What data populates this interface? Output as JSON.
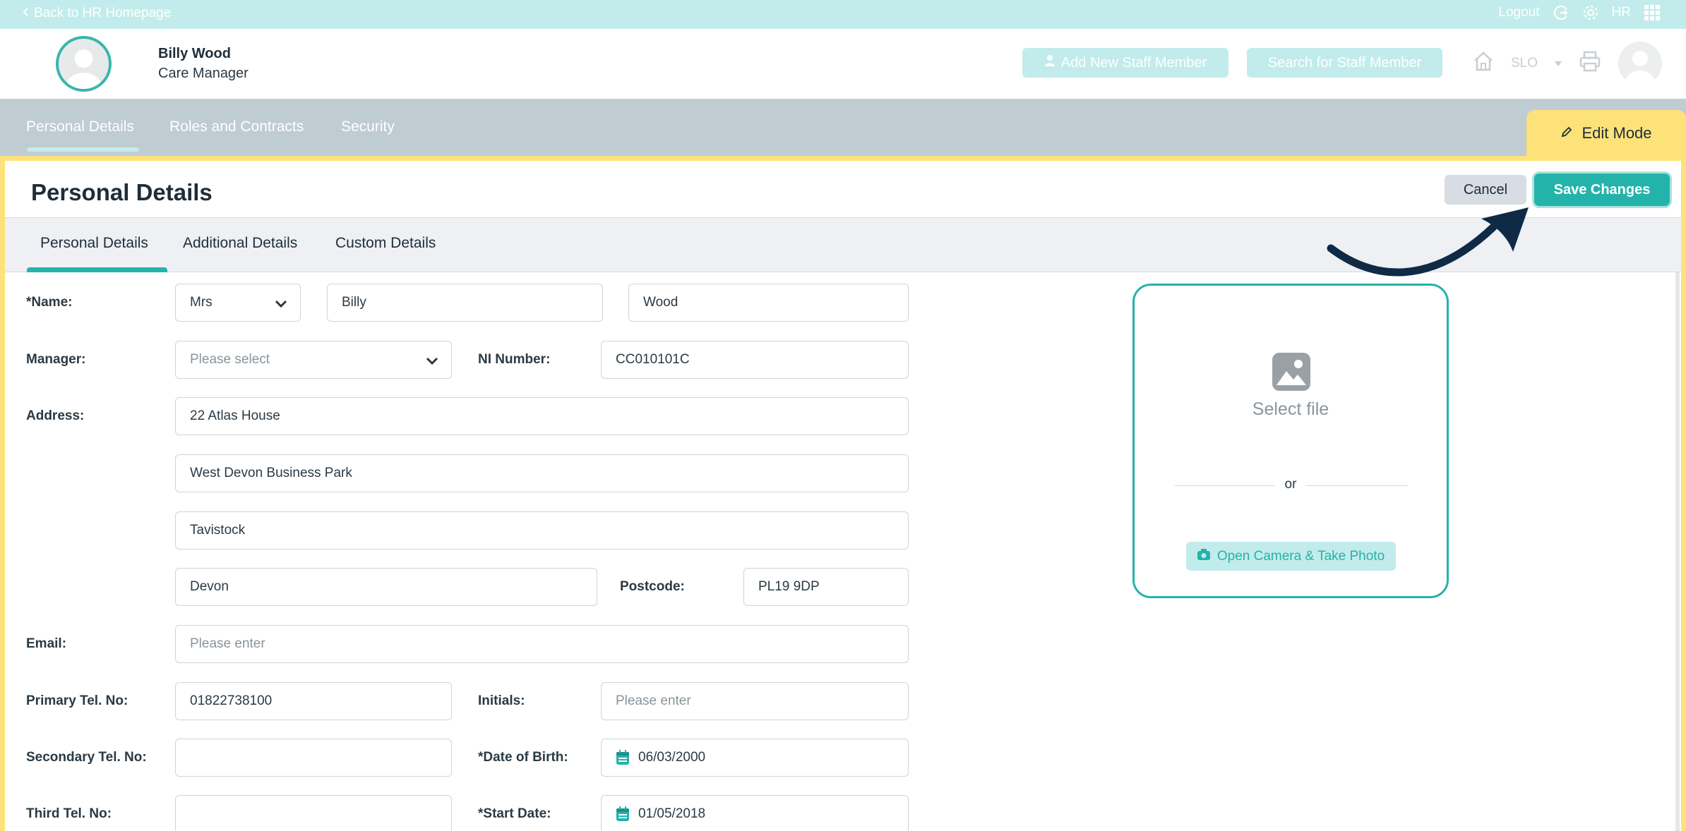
{
  "top_bar": {
    "back_link": "Back to HR Homepage",
    "logout": "Logout",
    "hr": "HR"
  },
  "user": {
    "name": "Billy Wood",
    "role": "Care Manager"
  },
  "header_actions": {
    "add_staff": "Add New Staff Member",
    "search_staff": "Search for Staff Member",
    "site": "SLO"
  },
  "main_tabs": [
    {
      "label": "Personal Details",
      "active": true
    },
    {
      "label": "Roles and Contracts",
      "active": false
    },
    {
      "label": "Security",
      "active": false
    }
  ],
  "edit_mode": "Edit Mode",
  "page": {
    "title": "Personal Details",
    "cancel": "Cancel",
    "save": "Save Changes"
  },
  "sub_tabs": [
    {
      "label": "Personal Details",
      "active": true
    },
    {
      "label": "Additional Details",
      "active": false
    },
    {
      "label": "Custom Details",
      "active": false
    }
  ],
  "form": {
    "name_label": "*Name:",
    "title_value": "Mrs",
    "first_name": "Billy",
    "last_name": "Wood",
    "manager_label": "Manager:",
    "manager_placeholder": "Please select",
    "ni_label": "NI Number:",
    "ni_value": "CC010101C",
    "address_label": "Address:",
    "address_line1": "22 Atlas House",
    "address_line2": "West Devon Business Park",
    "address_line3": "Tavistock",
    "address_line4": "Devon",
    "postcode_label": "Postcode:",
    "postcode_value": "PL19 9DP",
    "email_label": "Email:",
    "email_placeholder": "Please enter",
    "primary_tel_label": "Primary Tel. No:",
    "primary_tel_value": "01822738100",
    "initials_label": "Initials:",
    "initials_placeholder": "Please enter",
    "secondary_tel_label": "Secondary Tel. No:",
    "secondary_tel_value": "",
    "dob_label": "*Date of Birth:",
    "dob_value": "06/03/2000",
    "third_tel_label": "Third Tel. No:",
    "third_tel_value": "",
    "start_date_label": "*Start Date:",
    "start_date_value": "01/05/2018"
  },
  "photo": {
    "select_file": "Select file",
    "or": "or",
    "camera": "Open Camera & Take Photo"
  },
  "colors": {
    "accent_teal": "#24b3aa",
    "light_teal": "#c2eceb",
    "edit_yellow": "#fde27a",
    "nav_grey": "#bfccd2",
    "arrow_navy": "#0f2a44"
  },
  "icons": [
    "chevron-left-icon",
    "logout-icon",
    "gear-icon",
    "apps-grid-icon",
    "user-plus-icon",
    "home-icon",
    "caret-down-icon",
    "printer-icon",
    "pencil-icon",
    "chevron-down-icon",
    "calendar-icon",
    "image-icon",
    "camera-icon",
    "curved-arrow-icon"
  ]
}
